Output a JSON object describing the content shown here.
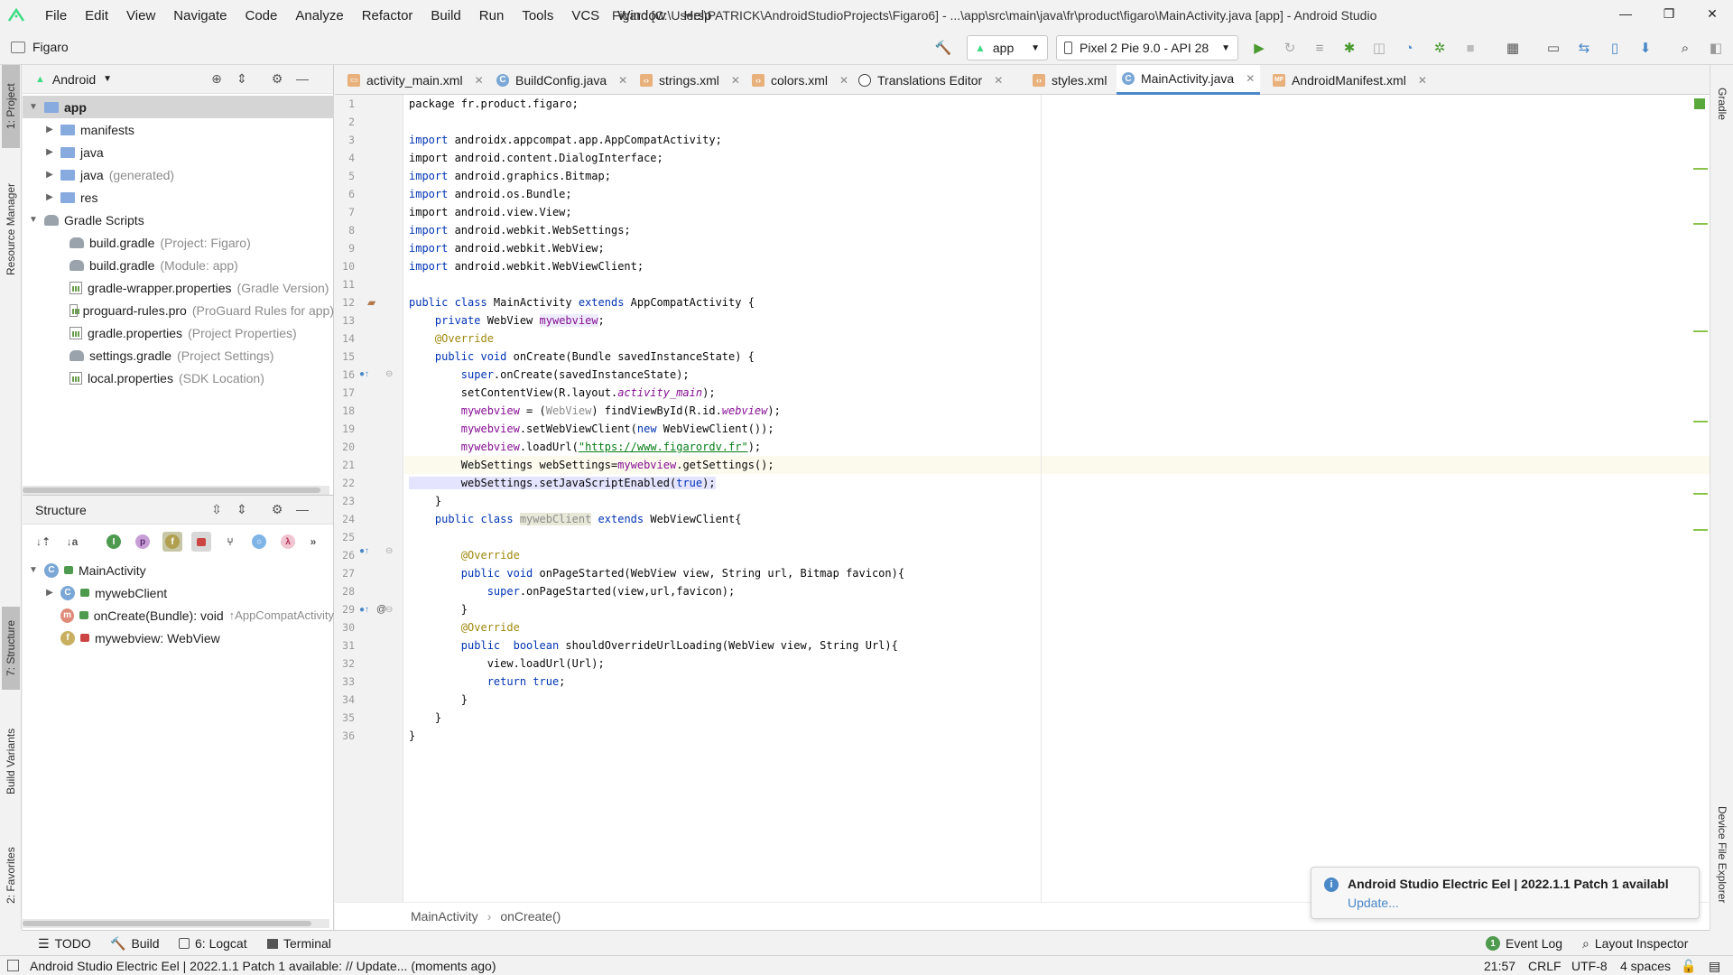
{
  "menubar": {
    "items": [
      "File",
      "Edit",
      "View",
      "Navigate",
      "Code",
      "Analyze",
      "Refactor",
      "Build",
      "Run",
      "Tools",
      "VCS",
      "Window",
      "Help"
    ],
    "title": "Figaro [C:\\Users\\PATRICK\\AndroidStudioProjects\\Figaro6] - ...\\app\\src\\main\\java\\fr\\product\\figaro\\MainActivity.java [app] - Android Studio",
    "minimize": "—",
    "maximize": "❐",
    "close": "✕"
  },
  "navbar": {
    "project": "Figaro",
    "run_config": "app",
    "device": "Pixel 2 Pie 9.0 - API 28"
  },
  "left_stripe": {
    "project_tab": "1: Project",
    "resource_manager_tab": "Resource Manager",
    "structure_tab": "7: Structure",
    "build_variants_tab": "Build Variants",
    "favorites_tab": "2: Favorites"
  },
  "right_stripe": {
    "gradle_tab": "Gradle",
    "device_file_explorer_tab": "Device File Explorer"
  },
  "project_panel": {
    "view_selector": "Android",
    "tree": [
      {
        "label": "app",
        "hint": ""
      },
      {
        "label": "manifests",
        "hint": ""
      },
      {
        "label": "java",
        "hint": ""
      },
      {
        "label": "java",
        "hint": "(generated)"
      },
      {
        "label": "res",
        "hint": ""
      },
      {
        "label": "Gradle Scripts",
        "hint": ""
      },
      {
        "label": "build.gradle",
        "hint": "(Project: Figaro)"
      },
      {
        "label": "build.gradle",
        "hint": "(Module: app)"
      },
      {
        "label": "gradle-wrapper.properties",
        "hint": "(Gradle Version)"
      },
      {
        "label": "proguard-rules.pro",
        "hint": "(ProGuard Rules for app)"
      },
      {
        "label": "gradle.properties",
        "hint": "(Project Properties)"
      },
      {
        "label": "settings.gradle",
        "hint": "(Project Settings)"
      },
      {
        "label": "local.properties",
        "hint": "(SDK Location)"
      }
    ]
  },
  "structure_panel": {
    "title": "Structure",
    "tool_letters": {
      "p": "p",
      "f": "f",
      "lambda": "λ",
      "more": "»"
    },
    "items": [
      {
        "label": "MainActivity",
        "hint": ""
      },
      {
        "label": "mywebClient",
        "hint": ""
      },
      {
        "label": "onCreate(Bundle): void",
        "hint": "↑AppCompatActivity"
      },
      {
        "label": "mywebview: WebView",
        "hint": ""
      }
    ]
  },
  "tabs": [
    {
      "label": "activity_main.xml"
    },
    {
      "label": "BuildConfig.java"
    },
    {
      "label": "strings.xml"
    },
    {
      "label": "colors.xml"
    },
    {
      "label": "Translations Editor"
    },
    {
      "label": "styles.xml"
    },
    {
      "label": "MainActivity.java"
    },
    {
      "label": "AndroidManifest.xml"
    }
  ],
  "editor": {
    "line_numbers": [
      "1",
      "2",
      "3",
      "4",
      "5",
      "6",
      "7",
      "8",
      "9",
      "10",
      "11",
      "12",
      "13",
      "14",
      "15",
      "16",
      "17",
      "18",
      "19",
      "20",
      "21",
      "22",
      "23",
      "24",
      "25",
      "26",
      "27",
      "28",
      "29",
      "30",
      "31",
      "32",
      "33",
      "34",
      "35",
      "36"
    ],
    "lines": {
      "l1": "package fr.product.figaro;",
      "l3a": "import",
      "l3b": " androidx.appcompat.app.AppCompatActivity;",
      "l4": "import android.content.DialogInterface;",
      "l5a": "import",
      "l5b": " android.graphics.Bitmap;",
      "l6a": "import",
      "l6b": " android.os.Bundle;",
      "l7": "import android.view.View;",
      "l8a": "import",
      "l8b": " android.webkit.WebSettings;",
      "l9a": "import",
      "l9b": " android.webkit.WebView;",
      "l10a": "import",
      "l10b": " android.webkit.WebViewClient;",
      "l12a": "public class",
      "l12b": " MainActivity ",
      "l12c": "extends",
      "l12d": " AppCompatActivity {",
      "l13a": "    private",
      "l13b": " WebView ",
      "l13c": "mywebview",
      "l13d": ";",
      "l14": "    @Override",
      "l15a": "    public void",
      "l15b": " onCreate(Bundle savedInstanceState) {",
      "l16a": "        super",
      "l16b": ".onCreate(savedInstanceState);",
      "l17a": "        setContentView(R.layout.",
      "l17b": "activity_main",
      "l17c": ");",
      "l18a": "        mywebview",
      "l18b": " = (",
      "l18c": "WebView",
      "l18d": ") findViewById(R.id.",
      "l18e": "webview",
      "l18f": ");",
      "l19a": "        mywebview",
      "l19b": ".setWebViewClient(",
      "l19c": "new",
      "l19d": " WebViewClient());",
      "l20a": "        mywebview",
      "l20b": ".loadUrl(",
      "l20c": "\"https://www.figarordv.fr\"",
      "l20d": ");",
      "l21a": "        WebSettings webSettings=",
      "l21b": "mywebview",
      "l21c": ".getSettings();",
      "l22a": "        webSettings.setJavaScriptEnabled(",
      "l22b": "true",
      "l22c": ");",
      "l23": "    }",
      "l24a": "    public class",
      "l24b": " ",
      "l24c": "mywebClient",
      "l24d": " ",
      "l24e": "extends",
      "l24f": " WebViewClient{",
      "l26": "        @Override",
      "l27a": "        public void",
      "l27b": " onPageStarted(WebView view, String url, Bitmap favicon){",
      "l28a": "            super",
      "l28b": ".onPageStarted(view,url,favicon);",
      "l29": "        }",
      "l30": "        @Override",
      "l31a": "        public  boolean",
      "l31b": " shouldOverrideUrlLoading(WebView view, String Url){",
      "l32": "            view.loadUrl(Url);",
      "l33a": "            return true",
      "l33b": ";",
      "l34": "        }",
      "l35": "    }",
      "l36": "}"
    }
  },
  "breadcrumb": [
    "MainActivity",
    "onCreate()"
  ],
  "notification": {
    "title": "Android Studio Electric Eel | 2022.1.1 Patch 1 availabl",
    "link": "Update..."
  },
  "bottom_tools": {
    "todo": "TODO",
    "build": "Build",
    "logcat": "6: Logcat",
    "terminal": "Terminal",
    "event_log": "Event Log",
    "layout_inspector": "Layout Inspector"
  },
  "status": {
    "message": "Android Studio Electric Eel | 2022.1.1 Patch 1 available: // Update... (moments ago)",
    "position": "21:57",
    "line_sep": "CRLF",
    "encoding": "UTF-8",
    "indent": "4 spaces"
  },
  "colors": {
    "accent": "#4a88c7",
    "keyword": "#0033b3",
    "field": "#871094",
    "annotation": "#9e880d",
    "string": "#067d17"
  }
}
